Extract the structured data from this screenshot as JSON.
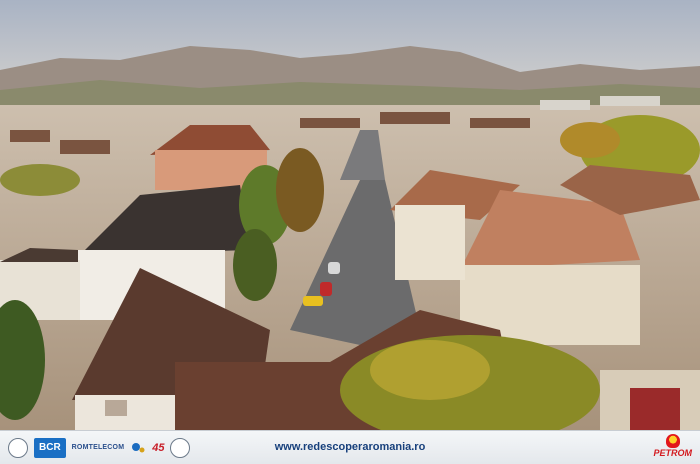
{
  "photo": {
    "description_icon": "town-panorama-photo",
    "colors": {
      "sky": "#b8c3d3",
      "mountains": "#8e8178",
      "roof": "#9a5a3c",
      "tree": "#9aa12a"
    }
  },
  "footer": {
    "url": "www.redescoperaromania.ro",
    "sponsors": {
      "logo1_icon": "emblem-circle-icon",
      "bcr_label": "BCR",
      "romtelecom_label": "ROMTELECOM",
      "logo4_icon": "dots-logo-icon",
      "logo5_label": "45",
      "logo6_icon": "seal-circle-icon"
    },
    "petrom_label": "PETROM"
  }
}
